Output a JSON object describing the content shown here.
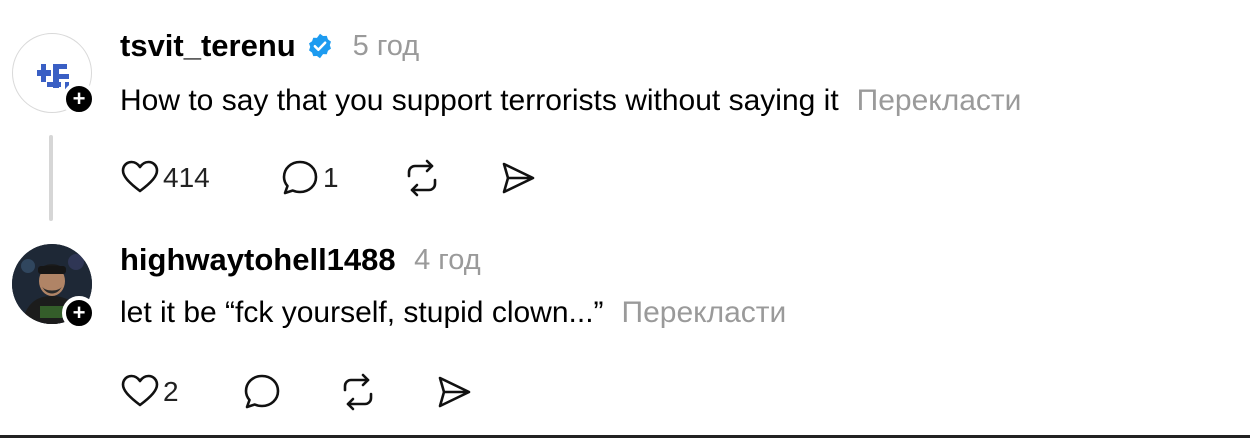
{
  "posts": [
    {
      "username": "tsvit_terenu",
      "verified": true,
      "timestamp": "5 год",
      "text": "How to say that you support terrorists without saying it",
      "translate_label": "Перекласти",
      "likes": "414",
      "replies": "1",
      "follow_glyph": "+"
    },
    {
      "username": "highwaytohell1488",
      "verified": false,
      "timestamp": "4 год",
      "text": "let it be “fck yourself, stupid clown...”",
      "translate_label": "Перекласти",
      "likes": "2",
      "replies": "",
      "follow_glyph": "+"
    }
  ],
  "icons": [
    "heart-icon",
    "comment-icon",
    "repost-icon",
    "share-icon",
    "verified-badge-icon",
    "plus-icon"
  ],
  "colors": {
    "verified": "#1d9bf0",
    "secondary_text": "#9a9a9a",
    "thread_line": "#d6d6d6",
    "text": "#000000"
  }
}
